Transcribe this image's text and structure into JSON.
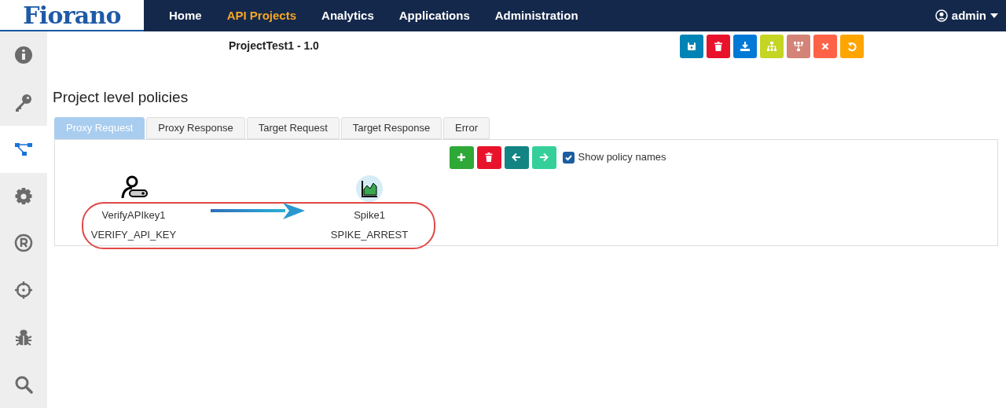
{
  "logo": "Fiorano",
  "nav": [
    {
      "label": "Home",
      "selected": false
    },
    {
      "label": "API Projects",
      "selected": true
    },
    {
      "label": "Analytics",
      "selected": false
    },
    {
      "label": "Applications",
      "selected": false
    },
    {
      "label": "Administration",
      "selected": false
    }
  ],
  "user": "admin",
  "sidebar": [
    {
      "kind": "info",
      "selected": false
    },
    {
      "kind": "key",
      "selected": false
    },
    {
      "kind": "flow",
      "selected": true
    },
    {
      "kind": "gear",
      "selected": false
    },
    {
      "kind": "registered",
      "selected": false
    },
    {
      "kind": "target",
      "selected": false
    },
    {
      "kind": "bug",
      "selected": false
    },
    {
      "kind": "search",
      "selected": false
    }
  ],
  "project_title": "ProjectTest1 - 1.0",
  "heading": "Project level policies",
  "tabs": [
    {
      "label": "Proxy Request",
      "selected": true
    },
    {
      "label": "Proxy Response",
      "selected": false
    },
    {
      "label": "Target Request",
      "selected": false
    },
    {
      "label": "Target Response",
      "selected": false
    },
    {
      "label": "Error",
      "selected": false
    }
  ],
  "show_policy_names": {
    "label": "Show policy names",
    "checked": true
  },
  "policies": [
    {
      "kind": "verify",
      "name": "VerifyAPIkey1",
      "type": "VERIFY_API_KEY"
    },
    {
      "kind": "spike",
      "name": "Spike1",
      "type": "SPIKE_ARREST"
    }
  ]
}
